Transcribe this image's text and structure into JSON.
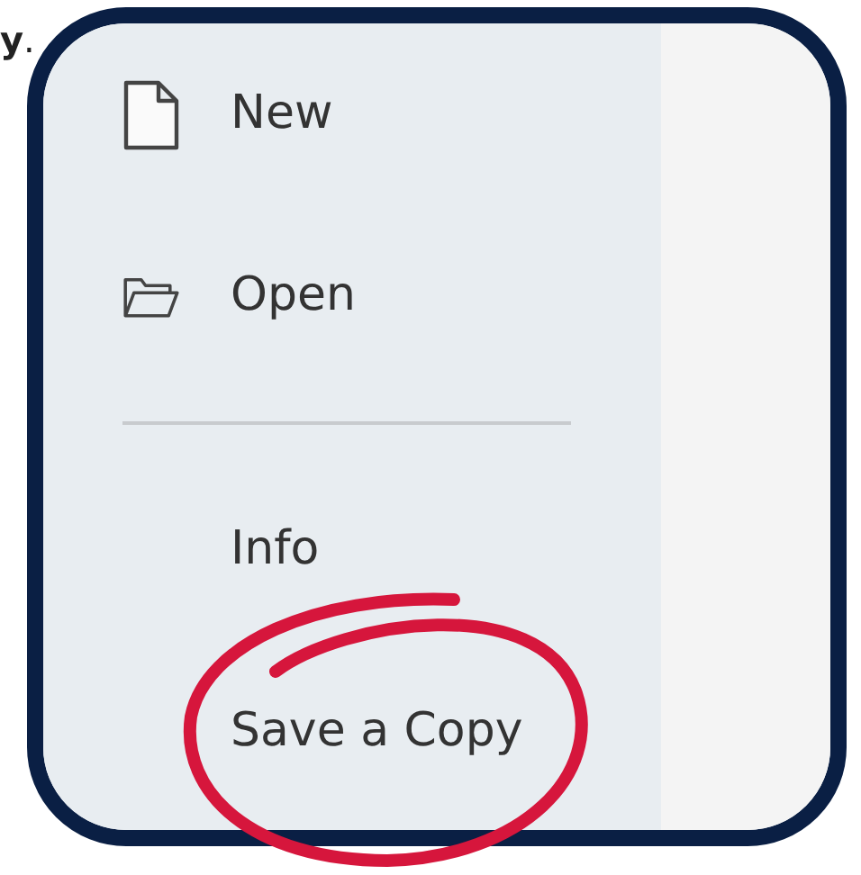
{
  "caption_fragment": "**y**.",
  "menu": [
    {
      "kind": "file",
      "label": "New"
    },
    {
      "kind": "folder",
      "label": "Open"
    },
    {
      "kind": "divider"
    },
    {
      "kind": "item",
      "label": "Info"
    },
    {
      "kind": "item",
      "label": "Save a Copy"
    }
  ]
}
